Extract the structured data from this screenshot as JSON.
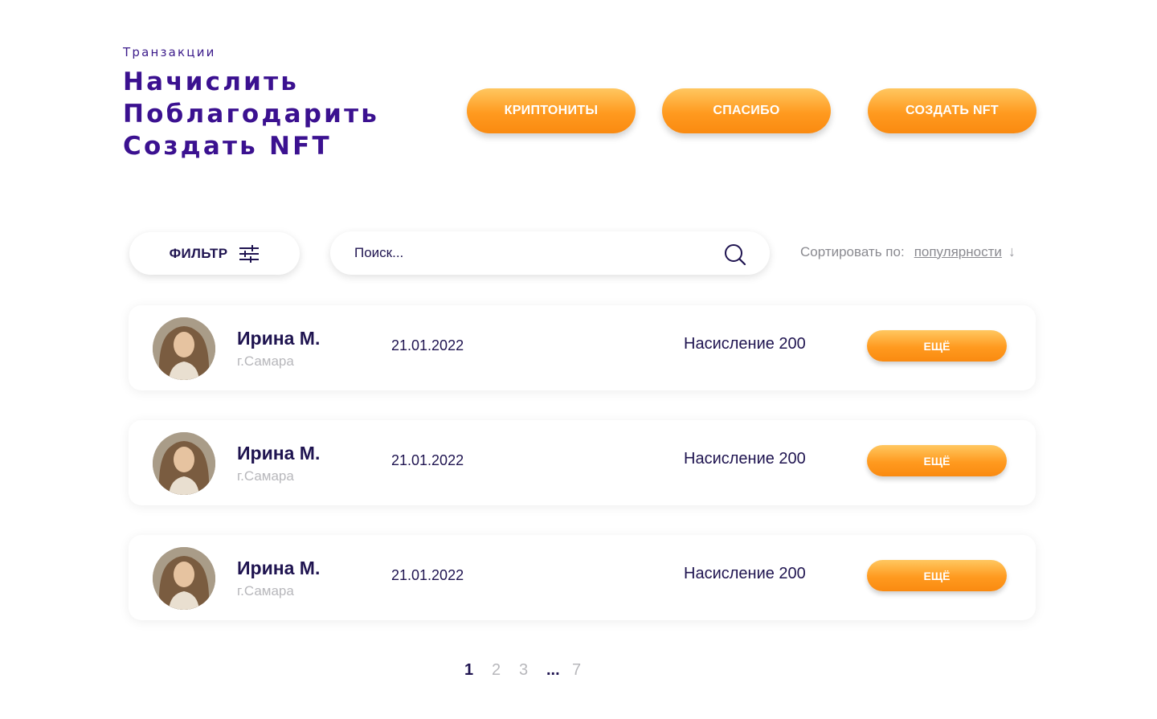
{
  "header": {
    "eyebrow": "Транзакции",
    "nav": [
      "Начислить",
      "Поблагодарить",
      "Создать NFT"
    ],
    "actions": [
      "КРИПТОНИТЫ",
      "СПАСИБО",
      "СОЗДАТЬ NFT"
    ]
  },
  "toolbar": {
    "filter_label": "ФИЛЬТР",
    "filter_icon": "sliders-icon",
    "search_placeholder": "Поиск...",
    "search_icon": "search-icon",
    "sort_label": "Сортировать по:",
    "sort_value": "популярности",
    "sort_arrow": "↓"
  },
  "rows": [
    {
      "name": "Ирина М.",
      "city": "г.Самара",
      "date": "21.01.2022",
      "amount": "Насисление 200",
      "more": "ЕЩЁ"
    },
    {
      "name": "Ирина М.",
      "city": "г.Самара",
      "date": "21.01.2022",
      "amount": "Насисление 200",
      "more": "ЕЩЁ"
    },
    {
      "name": "Ирина М.",
      "city": "г.Самара",
      "date": "21.01.2022",
      "amount": "Насисление 200",
      "more": "ЕЩЁ"
    }
  ],
  "pagination": {
    "pages": [
      "1",
      "2",
      "3",
      "7"
    ],
    "dots": "...",
    "active": "1"
  },
  "colors": {
    "accent": "#ff9a1f",
    "primary_text": "#1f1450",
    "heading": "#3b1190",
    "highlight": "#f1c4fb",
    "muted": "#b7b7bb"
  }
}
